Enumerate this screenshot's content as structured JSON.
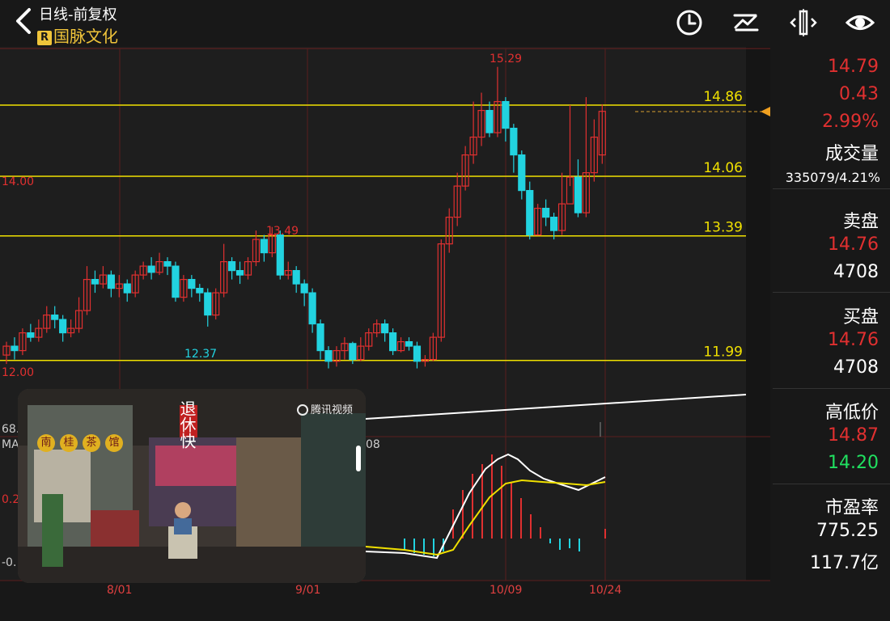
{
  "header": {
    "title": "日线-前复权",
    "badge": "R",
    "stock_name": "国脉文化"
  },
  "chart": {
    "price_lines": [
      {
        "label": "14.86",
        "value": 14.86
      },
      {
        "label": "14.06",
        "value": 14.06
      },
      {
        "label": "13.39",
        "value": 13.39
      },
      {
        "label": "11.99",
        "value": 11.99
      }
    ],
    "left_price_labels": [
      "14.00",
      "12.00"
    ],
    "peak_labels": [
      "15.29",
      "13.49",
      "12.37"
    ],
    "macd_partial_labels": [
      "68.",
      "MA",
      "08",
      "0.2",
      "-0."
    ],
    "x_labels": [
      "8/01",
      "9/01",
      "10/09",
      "10/24"
    ]
  },
  "side": {
    "last_price": "14.79",
    "change": "0.43",
    "change_pct": "2.99%",
    "volume_label": "成交量",
    "volume_value": "335079/4.21%",
    "ask_label": "卖盘",
    "ask_price": "14.76",
    "ask_vol": "4708",
    "bid_label": "买盘",
    "bid_price": "14.76",
    "bid_vol": "4708",
    "hl_label": "高低价",
    "high": "14.87",
    "low": "14.20",
    "pe_label": "市盈率",
    "pe_value": "775.25",
    "mcap": "117.7亿"
  },
  "video": {
    "watermark": "腾讯视频",
    "banner": "退休快",
    "shop_sign": [
      "南",
      "桂",
      "茶",
      "馆"
    ]
  },
  "colors": {
    "up": "#e03030",
    "down": "#22d3e0",
    "level": "#f0e000",
    "accent": "#f0c43a",
    "green": "#20e060"
  },
  "icons": [
    "back-arrow-icon",
    "clock-icon",
    "draw-line-icon",
    "resize-h-icon",
    "eye-icon"
  ]
}
